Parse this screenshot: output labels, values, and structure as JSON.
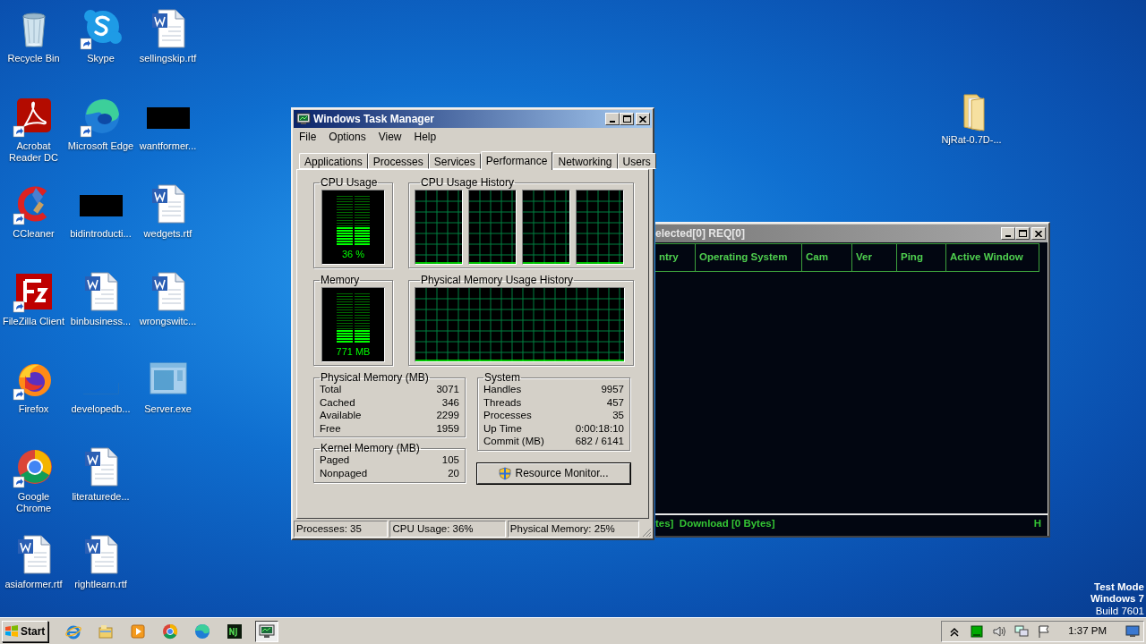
{
  "desktop_icons": [
    {
      "label": "Recycle Bin",
      "kind": "recycle-bin",
      "shortcut": false
    },
    {
      "label": "Acrobat Reader DC",
      "kind": "acrobat",
      "shortcut": true
    },
    {
      "label": "CCleaner",
      "kind": "ccleaner",
      "shortcut": true
    },
    {
      "label": "FileZilla Client",
      "kind": "filezilla",
      "shortcut": true
    },
    {
      "label": "Firefox",
      "kind": "firefox",
      "shortcut": true
    },
    {
      "label": "Google Chrome",
      "kind": "chrome",
      "shortcut": true
    },
    {
      "label": "asiaformer.rtf",
      "kind": "document",
      "shortcut": false
    },
    {
      "label": "Skype",
      "kind": "skype",
      "shortcut": true
    },
    {
      "label": "Microsoft Edge",
      "kind": "edge",
      "shortcut": true
    },
    {
      "label": "bidintroducti...",
      "kind": "redacted",
      "shortcut": false
    },
    {
      "label": "binbusiness...",
      "kind": "document",
      "shortcut": false
    },
    {
      "label": "developedb...",
      "kind": "blank",
      "shortcut": false
    },
    {
      "label": "literaturede...",
      "kind": "document",
      "shortcut": false
    },
    {
      "label": "rightlearn.rtf",
      "kind": "document",
      "shortcut": false
    },
    {
      "label": "sellingskip.rtf",
      "kind": "document",
      "shortcut": false
    },
    {
      "label": "wantformer...",
      "kind": "redacted",
      "shortcut": false
    },
    {
      "label": "wedgets.rtf",
      "kind": "document",
      "shortcut": false
    },
    {
      "label": "wrongswitc...",
      "kind": "document",
      "shortcut": false
    },
    {
      "label": "Server.exe",
      "kind": "program",
      "shortcut": false
    }
  ],
  "folder_icon": {
    "label": "NjRat-0.7D-..."
  },
  "task_manager": {
    "title": "Windows Task Manager",
    "menu": [
      "File",
      "Options",
      "View",
      "Help"
    ],
    "tabs": [
      {
        "label": "Applications",
        "selected": false
      },
      {
        "label": "Processes",
        "selected": false
      },
      {
        "label": "Services",
        "selected": false
      },
      {
        "label": "Performance",
        "selected": true
      },
      {
        "label": "Networking",
        "selected": false
      },
      {
        "label": "Users",
        "selected": false
      }
    ],
    "cpu_usage": {
      "title": "CPU Usage",
      "level": 0.36,
      "reading": "36 %"
    },
    "cpu_history": {
      "title": "CPU Usage History"
    },
    "memory": {
      "title": "Memory",
      "level": 0.25,
      "reading": "771 MB"
    },
    "memory_history": {
      "title": "Physical Memory Usage History"
    },
    "physical_memory": {
      "title": "Physical Memory (MB)",
      "rows": [
        {
          "label": "Total",
          "value": "3071"
        },
        {
          "label": "Cached",
          "value": "346"
        },
        {
          "label": "Available",
          "value": "2299"
        },
        {
          "label": "Free",
          "value": "1959"
        }
      ]
    },
    "kernel_memory": {
      "title": "Kernel Memory (MB)",
      "rows": [
        {
          "label": "Paged",
          "value": "105"
        },
        {
          "label": "Nonpaged",
          "value": "20"
        }
      ]
    },
    "system": {
      "title": "System",
      "rows": [
        {
          "label": "Handles",
          "value": "9957"
        },
        {
          "label": "Threads",
          "value": "457"
        },
        {
          "label": "Processes",
          "value": "35"
        },
        {
          "label": "Up Time",
          "value": "0:00:18:10"
        },
        {
          "label": "Commit (MB)",
          "value": "682 / 6141"
        }
      ]
    },
    "resource_monitor_button": "Resource Monitor...",
    "status_bar": [
      "Processes: 35",
      "CPU Usage: 36%",
      "Physical Memory: 25%"
    ]
  },
  "njrat_window": {
    "title": "elected[0] REQ[0]",
    "columns": [
      "ntry",
      "Operating System",
      "Cam",
      "Ver",
      "Ping",
      "Active Window"
    ],
    "status": "tes]  Download [0 Bytes]",
    "status_right": "H"
  },
  "watermark_text": [
    "Test Mode",
    "Windows 7",
    "Build 7601"
  ],
  "taskbar": {
    "start": "Start",
    "apps": [
      {
        "kind": "ie",
        "active": false
      },
      {
        "kind": "explorer",
        "active": false
      },
      {
        "kind": "media",
        "active": false
      },
      {
        "kind": "chrome",
        "active": false
      },
      {
        "kind": "edge",
        "active": false
      },
      {
        "kind": "njrat",
        "active": false
      },
      {
        "kind": "taskmanager",
        "active": true
      }
    ],
    "tray": [
      {
        "kind": "show-hidden"
      },
      {
        "kind": "green-app"
      },
      {
        "kind": "volume"
      },
      {
        "kind": "network"
      },
      {
        "kind": "flag"
      }
    ],
    "time": "1:37 PM"
  }
}
